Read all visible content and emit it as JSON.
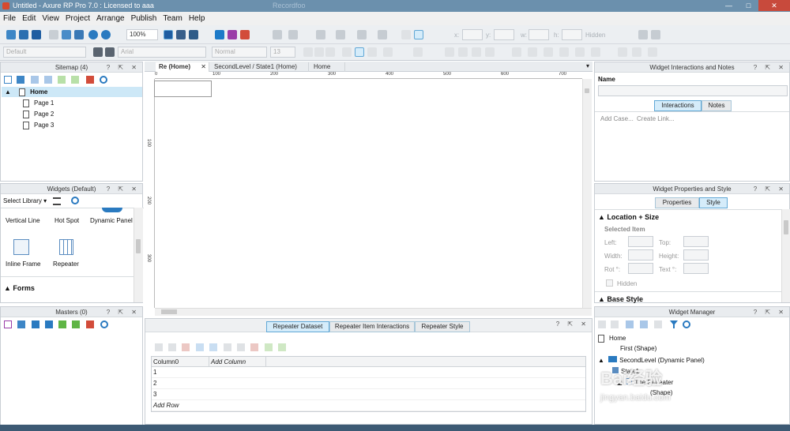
{
  "window": {
    "title": "Untitled - Axure RP Pro 7.0 : Licensed to aaa",
    "ghost_title": "Recordfoo",
    "min": "—",
    "max": "□",
    "close": "✕"
  },
  "menu": [
    "File",
    "Edit",
    "View",
    "Project",
    "Arrange",
    "Publish",
    "Team",
    "Help"
  ],
  "toolbar": {
    "zoom": "100%",
    "style_default": "Default",
    "font": "Arial",
    "weight": "Normal",
    "size": "13",
    "x_label": "x:",
    "y_label": "y:",
    "w_label": "w:",
    "h_label": "h:",
    "hidden_label": "Hidden"
  },
  "sitemap": {
    "title": "Sitemap (4)",
    "home": "Home",
    "pages": [
      "Page 1",
      "Page 2",
      "Page 3"
    ]
  },
  "widgets": {
    "title": "Widgets (Default)",
    "select_library": "Select Library",
    "items": [
      "Vertical Line",
      "Hot Spot",
      "Dynamic Panel",
      "Inline Frame",
      "Repeater"
    ],
    "section": "Forms"
  },
  "masters": {
    "title": "Masters (0)"
  },
  "doc_tabs": [
    "Re (Home)",
    "SecondLevel / State1 (Home)",
    "Home"
  ],
  "ruler_h": [
    "0",
    "100",
    "200",
    "300",
    "400",
    "500",
    "600",
    "700"
  ],
  "ruler_v": [
    "100",
    "200",
    "300"
  ],
  "repeater": {
    "tabs": [
      "Repeater Dataset",
      "Repeater Item Interactions",
      "Repeater Style"
    ],
    "col0": "Column0",
    "add_column": "Add Column",
    "rows": [
      "1",
      "2",
      "3"
    ],
    "add_row": "Add Row"
  },
  "interactions": {
    "title": "Widget Interactions and Notes",
    "name_label": "Name",
    "tab_interactions": "Interactions",
    "tab_notes": "Notes",
    "add_case": "Add Case...",
    "create_link": "Create Link..."
  },
  "props": {
    "title": "Widget Properties and Style",
    "tab_properties": "Properties",
    "tab_style": "Style",
    "section": "Location + Size",
    "selected": "Selected Item",
    "left": "Left:",
    "top": "Top:",
    "width": "Width:",
    "height": "Height:",
    "rot": "Rot °:",
    "text": "Text °:",
    "hidden": "Hidden",
    "base_style": "Base Style"
  },
  "manager": {
    "title": "Widget Manager",
    "items": [
      "Home",
      "First (Shape)",
      "SecondLevel (Dynamic Panel)",
      "State1",
      "The Repeater",
      "(Shape)"
    ]
  },
  "panel_controls": "? ⇱ ✕",
  "watermark": "Bai经验",
  "watermark_url": "jingyan.baidu.com",
  "colors": {
    "accent": "#61a8d6",
    "titlebar": "#6b90ad",
    "selection": "#cde8f7"
  }
}
